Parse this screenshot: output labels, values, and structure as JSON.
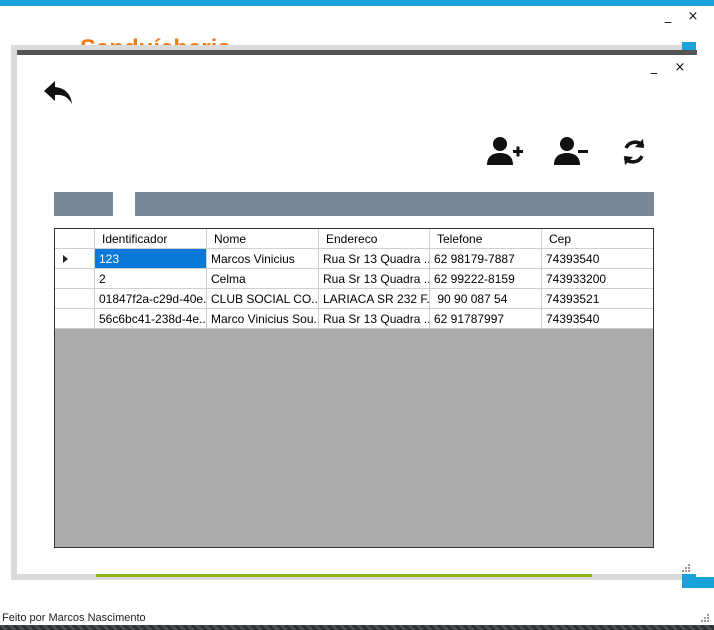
{
  "main_window": {
    "brand_title": "Sanduícheria",
    "minimize_label": "_",
    "close_label": "×",
    "footer_text": "Feito por Marcos Nascimento"
  },
  "dialog": {
    "minimize_label": "_",
    "close_label": "×",
    "toolbar_icons": [
      "add-user-icon",
      "remove-user-icon",
      "refresh-icon"
    ],
    "back_icon": "back-arrow-icon"
  },
  "grid": {
    "columns": [
      "Identificador",
      "Nome",
      "Endereco",
      "Telefone",
      "Cep"
    ],
    "rows": [
      [
        "123",
        "Marcos Vinicius",
        "Rua Sr 13 Quadra ...",
        "62 98179-7887",
        "74393540"
      ],
      [
        "2",
        "Celma",
        "Rua Sr 13 Quadra ...",
        "62 99222-8159",
        "743933200"
      ],
      [
        "01847f2a-c29d-40e...",
        "CLUB SOCIAL CO...",
        "LARIACA SR 232 F...",
        " 90 90 087 54",
        "74393521"
      ],
      [
        "56c6bc41-238d-4e...",
        "Marco Vinicius Sou...",
        "Rua Sr 13 Quadra ...",
        "62 91787997",
        "74393540"
      ]
    ],
    "selected_row": 0,
    "selected_color": "#0a78d7",
    "empty_area_color": "#ababab"
  },
  "colors": {
    "accent_blue": "#1aa3d9",
    "brand_orange": "#f07a18",
    "bar_gray": "#778899",
    "green_line": "#8fb51a"
  }
}
